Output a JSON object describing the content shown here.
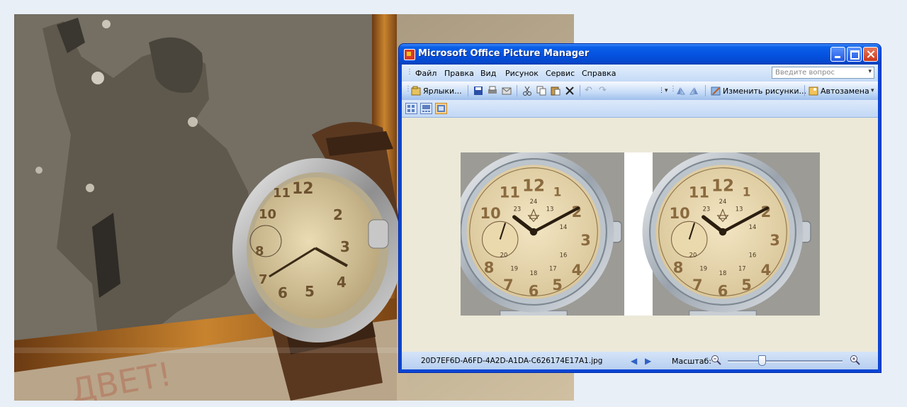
{
  "window": {
    "title": "Microsoft Office Picture Manager"
  },
  "menu": [
    {
      "label": "Файл"
    },
    {
      "label": "Правка"
    },
    {
      "label": "Вид"
    },
    {
      "label": "Рисунок"
    },
    {
      "label": "Сервис"
    },
    {
      "label": "Справка"
    }
  ],
  "help_search": {
    "placeholder": "Введите вопрос"
  },
  "toolbar": {
    "shortcuts_label": "Ярлыки...",
    "edit_pictures_label": "Изменить рисунки...",
    "autocorrect_label": "Автозамена"
  },
  "status": {
    "filename": "20D7EF6D-A6FD-4A2D-A1DA-C626174E17A1.jpg",
    "zoom_label": "Масштаб:",
    "zoom_fraction": 0.3
  },
  "icons": {
    "app": "picture-manager-icon",
    "prev": "previous-arrow-icon",
    "next": "next-arrow-icon"
  },
  "colors": {
    "titlebar": "#0552e0",
    "client_bg": "#ece9d8",
    "page_bg": "#e9eff7"
  }
}
